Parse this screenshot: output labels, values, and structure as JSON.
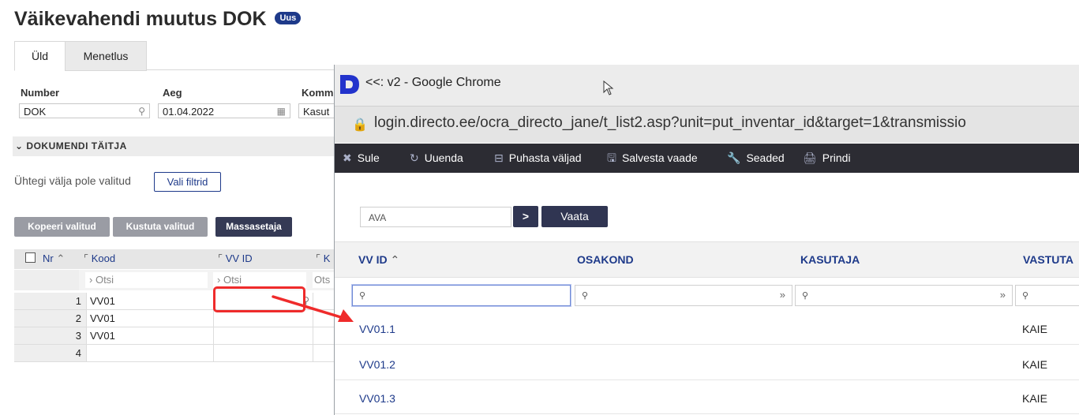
{
  "page": {
    "title": "Väikevahendi muutus DOK",
    "badge": "Uus",
    "tabs": [
      "Üld",
      "Menetlus"
    ],
    "fields": {
      "number_label": "Number",
      "number_value": "DOK",
      "aeg_label": "Aeg",
      "aeg_value": "01.04.2022",
      "kommentaar_label": "Komm",
      "kommentaar_value": "Kasut"
    },
    "section_title": "DOKUMENDI TÄITJA",
    "no_filter_text": "Ühtegi välja pole valitud",
    "choose_filters_button": "Vali filtrid",
    "buttons": {
      "copy_selected": "Kopeeri valitud",
      "delete_selected": "Kustuta valitud",
      "mass_setter": "Massasetaja"
    },
    "grid": {
      "headers": {
        "nr": "Nr",
        "kood": "Kood",
        "vvid": "VV ID",
        "k": "K"
      },
      "filter_placeholder": "Otsi",
      "filter_partial": "Ots",
      "rows": [
        {
          "nr": "1",
          "kood": "VV01",
          "vvid": ""
        },
        {
          "nr": "2",
          "kood": "VV01",
          "vvid": ""
        },
        {
          "nr": "3",
          "kood": "VV01",
          "vvid": ""
        },
        {
          "nr": "4",
          "kood": "",
          "vvid": ""
        }
      ]
    }
  },
  "popup": {
    "window_title": "<<: v2 - Google Chrome",
    "url": "login.directo.ee/ocra_directo_jane/t_list2.asp?unit=put_inventar_id&target=1&transmissio",
    "toolbar": {
      "close": "Sule",
      "refresh": "Uuenda",
      "clear_fields": "Puhasta väljad",
      "save_view": "Salvesta vaade",
      "settings": "Seaded",
      "print": "Prindi"
    },
    "search": {
      "value": "AVA",
      "go": ">",
      "view": "Vaata"
    },
    "columns": [
      "VV ID",
      "OSAKOND",
      "KASUTAJA",
      "VASTUTA"
    ],
    "rows": [
      {
        "vvid": "VV01.1",
        "vastutaja": "KAIE"
      },
      {
        "vvid": "VV01.2",
        "vastutaja": "KAIE"
      },
      {
        "vvid": "VV01.3",
        "vastutaja": "KAIE"
      }
    ]
  },
  "colors": {
    "accent_blue": "#1e3a8a",
    "toolbar_dark": "#2c2c33",
    "annotation_red": "#ef2b2b",
    "logo_blue": "#2233cc"
  }
}
